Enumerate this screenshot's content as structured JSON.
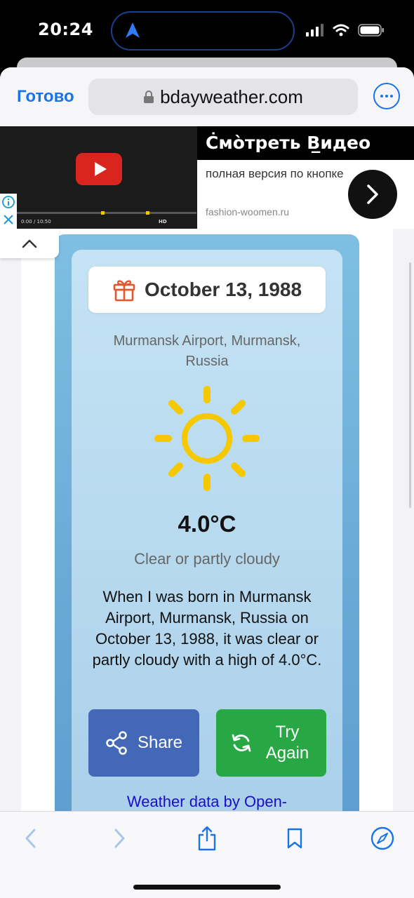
{
  "status_bar": {
    "time": "20:24"
  },
  "browser": {
    "done_label": "Готово",
    "url": "bdayweather.com"
  },
  "ad": {
    "title": "Ċмо̀треть В̲идео",
    "body": "полная версия по кнопке",
    "domain": "fashion-woomen.ru",
    "video_time": "0:00 / 10:50",
    "video_hd": "HD"
  },
  "weather": {
    "date": "October 13, 1988",
    "location": "Murmansk Airport, Murmansk, Russia",
    "temperature": "4.0°C",
    "condition": "Clear or partly cloudy",
    "description": "When I was born in Murmansk Airport, Murmansk, Russia on October 13, 1988, it was clear or partly cloudy with a high of 4.0°C.",
    "share_label": "Share",
    "try_again_label": "Try Again",
    "attribution": "Weather data by Open-"
  },
  "icons": {
    "gift": "gift-icon",
    "sun": "sun-icon",
    "share": "share-icon",
    "refresh": "refresh-icon",
    "lock": "lock-icon"
  },
  "colors": {
    "accent": "#1a73e8",
    "share_button": "#4468b8",
    "try_again_button": "#28a745",
    "sun": "#f5c800",
    "gift": "#e4572e"
  }
}
